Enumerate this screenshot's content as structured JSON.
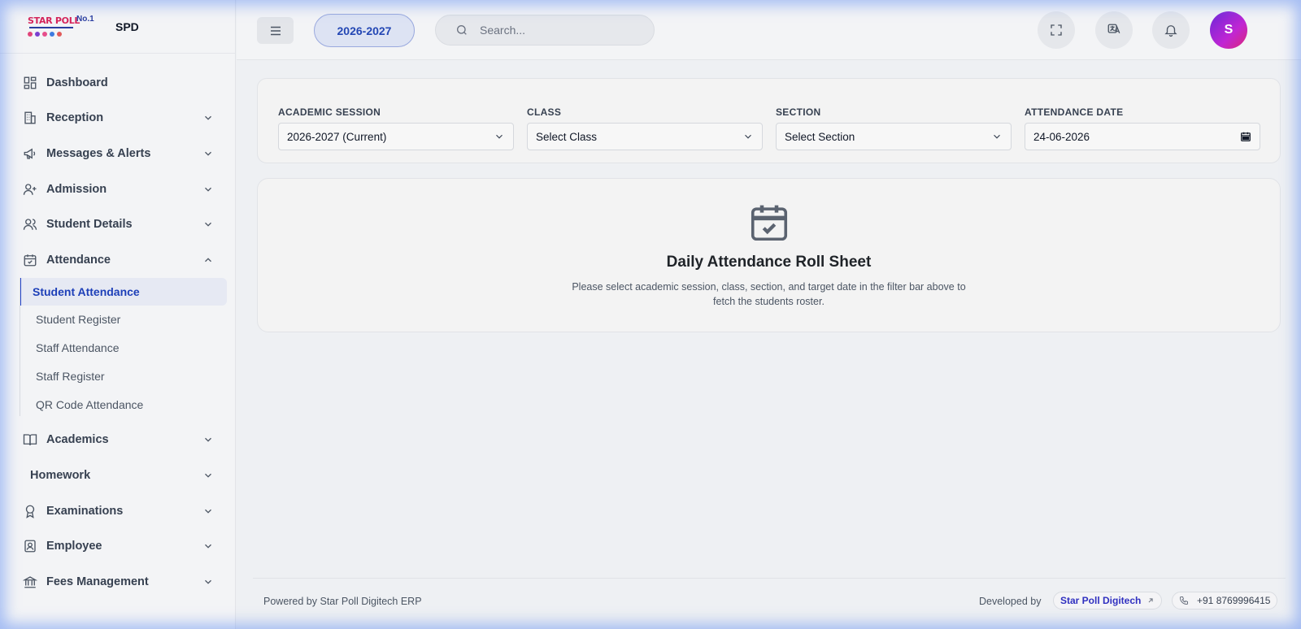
{
  "brand": {
    "logo_text": "STAR POLL",
    "logo_badge": "No.1",
    "short_name": "SPD"
  },
  "colors": {
    "accent": "#2447b4",
    "active_bg": "#e6e9f3",
    "avatar_from": "#6d28d9",
    "avatar_to": "#db2777",
    "dev_link": "#3030c0"
  },
  "sidebar": {
    "items": [
      {
        "label": "Dashboard",
        "icon": "dashboard-icon"
      },
      {
        "label": "Reception",
        "icon": "building-icon"
      },
      {
        "label": "Messages & Alerts",
        "icon": "megaphone-icon"
      },
      {
        "label": "Admission",
        "icon": "user-plus-icon"
      },
      {
        "label": "Student Details",
        "icon": "users-icon"
      },
      {
        "label": "Attendance",
        "icon": "calendar-check-icon"
      },
      {
        "label": "Academics",
        "icon": "book-icon"
      },
      {
        "label": "Homework",
        "icon": ""
      },
      {
        "label": "Examinations",
        "icon": "award-icon"
      },
      {
        "label": "Employee",
        "icon": "id-badge-icon"
      },
      {
        "label": "Fees Management",
        "icon": "bank-icon"
      }
    ],
    "attendance_sub": [
      {
        "label": "Student Attendance",
        "active": true
      },
      {
        "label": "Student Register"
      },
      {
        "label": "Staff Attendance"
      },
      {
        "label": "Staff Register"
      },
      {
        "label": "QR Code Attendance"
      }
    ]
  },
  "header": {
    "session": "2026-2027",
    "search_placeholder": "Search...",
    "avatar_initial": "S"
  },
  "filters": {
    "session": {
      "label": "ACADEMIC SESSION",
      "value": "2026-2027 (Current)"
    },
    "class": {
      "label": "CLASS",
      "value": "Select Class"
    },
    "section": {
      "label": "SECTION",
      "value": "Select Section"
    },
    "date": {
      "label": "ATTENDANCE DATE",
      "value": "24-06-2026"
    }
  },
  "empty_state": {
    "title": "Daily Attendance Roll Sheet",
    "description": "Please select academic session, class, section, and target date in the filter bar above to fetch the students roster."
  },
  "footer": {
    "powered_by": "Powered by Star Poll Digitech ERP",
    "developed_by": "Developed by",
    "developer": "Star Poll Digitech",
    "phone": "+91 8769996415"
  }
}
